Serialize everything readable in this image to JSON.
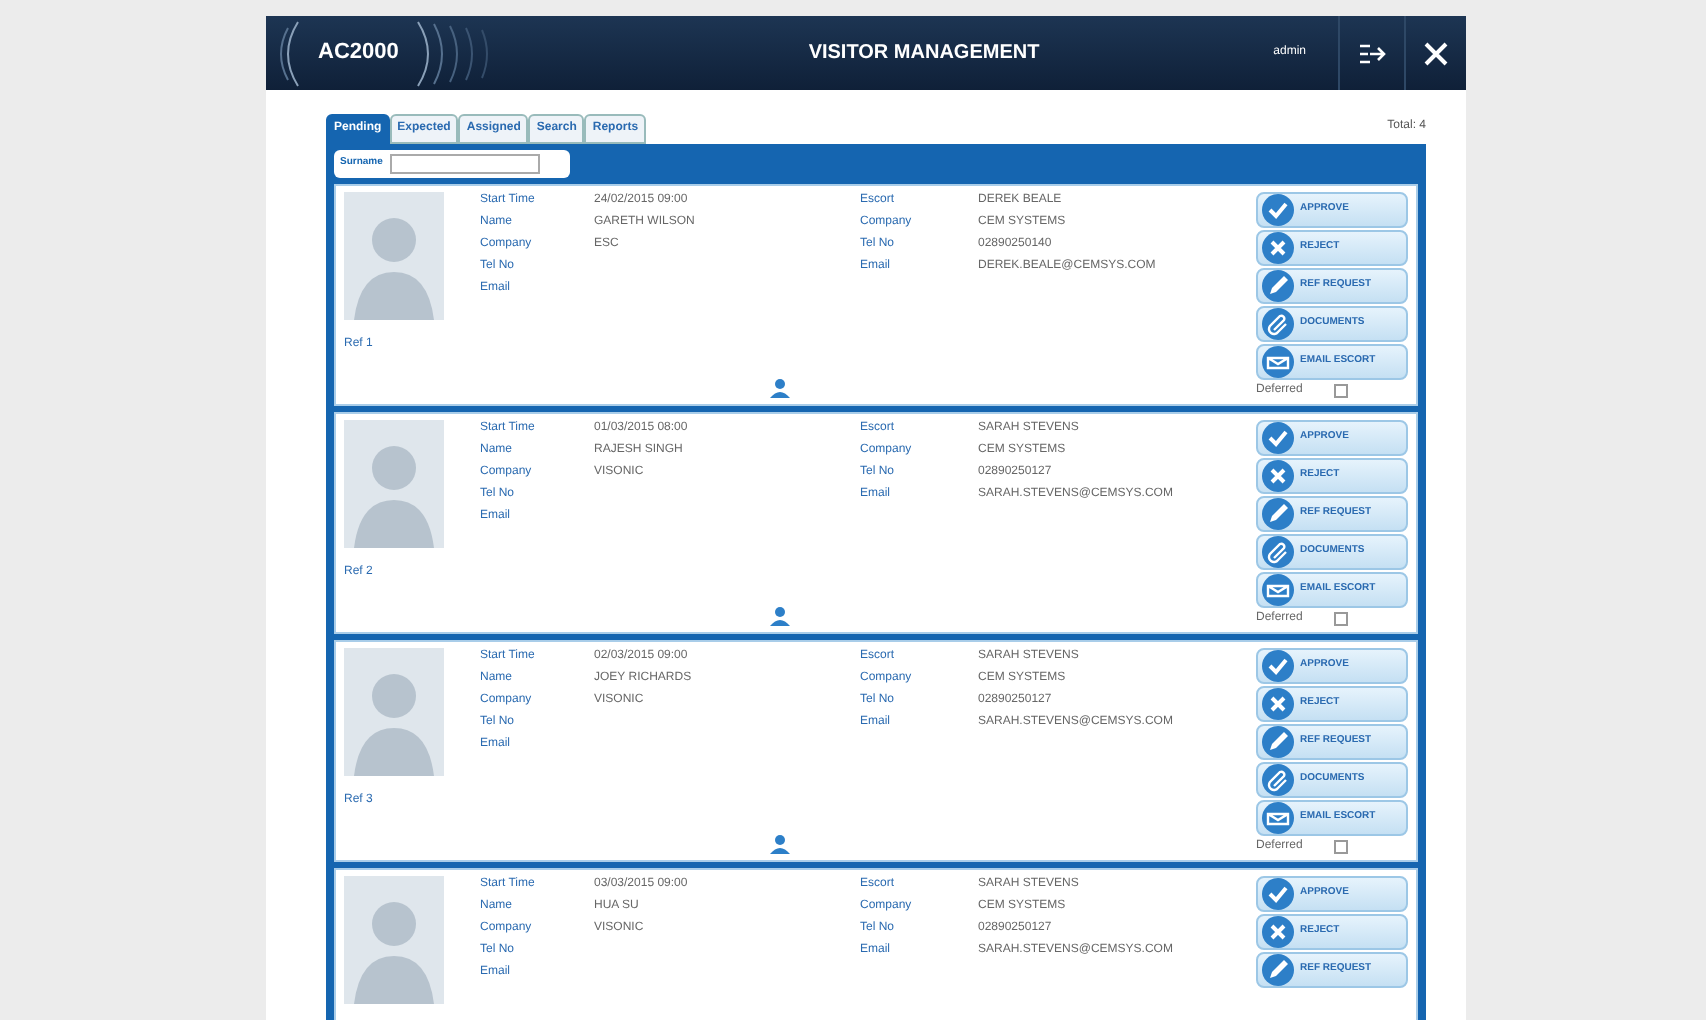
{
  "header": {
    "logo": "AC2000",
    "title": "VISITOR MANAGEMENT",
    "user": "admin"
  },
  "tabs": [
    {
      "label": "Pending",
      "selected": true
    },
    {
      "label": "Expected",
      "selected": false
    },
    {
      "label": "Assigned",
      "selected": false
    },
    {
      "label": "Search",
      "selected": false
    },
    {
      "label": "Reports",
      "selected": false
    }
  ],
  "total": "Total: 4",
  "search": {
    "label": "Surname"
  },
  "visitors": [
    {
      "fields": [
        {
          "label": "Start Time",
          "value": "24/02/2015 09:00"
        },
        {
          "label": "Name",
          "value": "GARETH WILSON"
        },
        {
          "label": "Company",
          "value": "ESC"
        },
        {
          "label": "Tel No"
        },
        {
          "label": "Email"
        }
      ],
      "escort": [
        {
          "label": "Escort",
          "value": "DEREK BEALE"
        },
        {
          "label": "Company",
          "value": "CEM SYSTEMS"
        },
        {
          "label": "Tel No",
          "value": "02890250140"
        },
        {
          "label": "Email",
          "value": "DEREK.BEALE@CEMSYS.COM"
        }
      ],
      "ref": "Ref 1",
      "deferred": {
        "label": "Deferred",
        "checked": false
      },
      "buttons": [
        {
          "kind": "approve",
          "label": "APPROVE"
        },
        {
          "kind": "reject",
          "label": "REJECT"
        },
        {
          "kind": "edit",
          "label": "REF REQUEST"
        },
        {
          "kind": "attach",
          "label": "DOCUMENTS"
        },
        {
          "kind": "mail",
          "label": "EMAIL ESCORT"
        }
      ]
    },
    {
      "fields": [
        {
          "label": "Start Time",
          "value": "01/03/2015 08:00"
        },
        {
          "label": "Name",
          "value": "RAJESH SINGH"
        },
        {
          "label": "Company",
          "value": "VISONIC"
        },
        {
          "label": "Tel No"
        },
        {
          "label": "Email"
        }
      ],
      "escort": [
        {
          "label": "Escort",
          "value": "SARAH STEVENS"
        },
        {
          "label": "Company",
          "value": "CEM SYSTEMS"
        },
        {
          "label": "Tel No",
          "value": "02890250127"
        },
        {
          "label": "Email",
          "value": "SARAH.STEVENS@CEMSYS.COM"
        }
      ],
      "ref": "Ref 2",
      "deferred": {
        "label": "Deferred",
        "checked": false
      },
      "buttons": [
        {
          "kind": "approve",
          "label": "APPROVE"
        },
        {
          "kind": "reject",
          "label": "REJECT"
        },
        {
          "kind": "edit",
          "label": "REF REQUEST"
        },
        {
          "kind": "attach",
          "label": "DOCUMENTS"
        },
        {
          "kind": "mail",
          "label": "EMAIL ESCORT"
        }
      ]
    },
    {
      "fields": [
        {
          "label": "Start Time",
          "value": "02/03/2015 09:00"
        },
        {
          "label": "Name",
          "value": "JOEY RICHARDS"
        },
        {
          "label": "Company",
          "value": "VISONIC"
        },
        {
          "label": "Tel No"
        },
        {
          "label": "Email"
        }
      ],
      "escort": [
        {
          "label": "Escort",
          "value": "SARAH STEVENS"
        },
        {
          "label": "Company",
          "value": "CEM SYSTEMS"
        },
        {
          "label": "Tel No",
          "value": "02890250127"
        },
        {
          "label": "Email",
          "value": "SARAH.STEVENS@CEMSYS.COM"
        }
      ],
      "ref": "Ref 3",
      "deferred": {
        "label": "Deferred",
        "checked": false
      },
      "buttons": [
        {
          "kind": "approve",
          "label": "APPROVE"
        },
        {
          "kind": "reject",
          "label": "REJECT"
        },
        {
          "kind": "edit",
          "label": "REF REQUEST"
        },
        {
          "kind": "attach",
          "label": "DOCUMENTS"
        },
        {
          "kind": "mail",
          "label": "EMAIL ESCORT"
        }
      ]
    },
    {
      "fields": [
        {
          "label": "Start Time",
          "value": "03/03/2015 09:00"
        },
        {
          "label": "Name",
          "value": "HUA SU"
        },
        {
          "label": "Company",
          "value": "VISONIC"
        },
        {
          "label": "Tel No"
        },
        {
          "label": "Email"
        }
      ],
      "escort": [
        {
          "label": "Escort",
          "value": "SARAH STEVENS"
        },
        {
          "label": "Company",
          "value": "CEM SYSTEMS"
        },
        {
          "label": "Tel No",
          "value": "02890250127"
        },
        {
          "label": "Email",
          "value": "SARAH.STEVENS@CEMSYS.COM"
        }
      ],
      "buttons": [
        {
          "kind": "approve",
          "label": "APPROVE"
        },
        {
          "kind": "reject",
          "label": "REJECT"
        },
        {
          "kind": "edit",
          "label": "REF REQUEST"
        }
      ]
    }
  ]
}
